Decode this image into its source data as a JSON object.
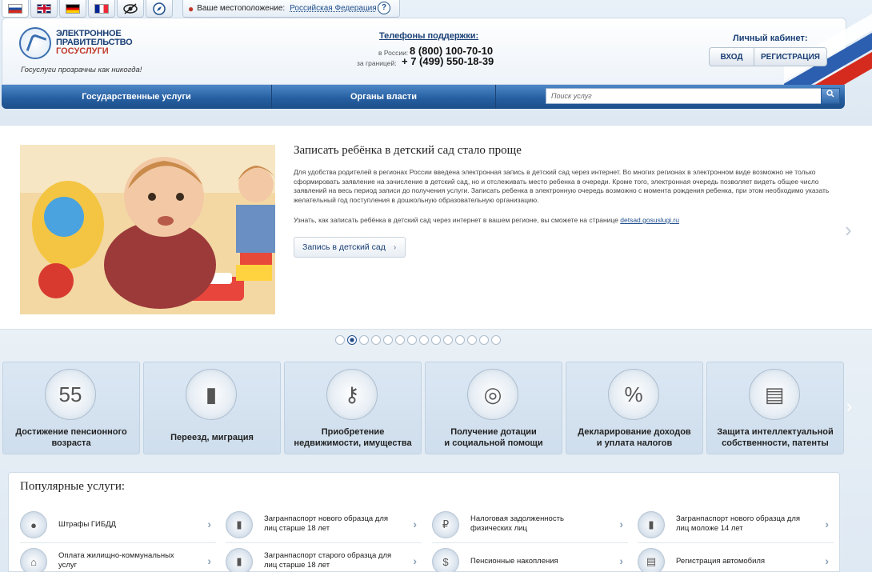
{
  "colors": {
    "brand_blue": "#245d9f",
    "accent_red": "#c0392b",
    "link": "#1f4e8c"
  },
  "flags": [
    "ru-flag-icon",
    "gb-flag-icon",
    "de-flag-icon",
    "fr-flag-icon",
    "low-vision-icon",
    "compass-icon"
  ],
  "location": {
    "label": "Ваше местоположение:",
    "value": "Российская Федерация"
  },
  "logo": {
    "line1": "ЭЛЕКТРОННОЕ",
    "line2": "ПРАВИТЕЛЬСТВО",
    "line3": "ГОСУСЛУГИ",
    "slogan": "Госуслуги прозрачны как никогда!"
  },
  "support": {
    "title": "Телефоны поддержки",
    "russia_label": "в России:",
    "russia_phone": "8 (800) 100-70-10",
    "abroad_label": "за границей:",
    "abroad_phone": "+ 7 (499) 550-18-39"
  },
  "cabinet": {
    "title": "Личный кабинет:",
    "login": "ВХОД",
    "register": "РЕГИСТРАЦИЯ"
  },
  "nav": {
    "services": "Государственные услуги",
    "authorities": "Органы власти"
  },
  "search": {
    "placeholder": "Поиск услуг"
  },
  "promo": {
    "title": "Записать ребёнка в детский сад стало проще",
    "text": "Для удобства родителей в регионах России введена электронная запись в детский сад через интернет. Во многих регионах в электронном виде возможно не только сформировать заявление на зачисление в детский сад, но и отслеживать место ребенка в очереди. Кроме того, электронная очередь позволяет видеть общее число заявлений на весь период записи до получения услуги. Записать ребенка в электронную очередь возможно с момента рождения ребенка, при этом необходимо указать желательный год поступления в дошкольную образовательную организацию.",
    "text2": "Узнать, как записать ребёнка в детский сад через интернет в вашем регионе, вы сможете на странице",
    "link": "detsad.gosuslugi.ru",
    "button": "Запись в детский сад"
  },
  "slider": {
    "total": 14,
    "active": 2
  },
  "categories": [
    {
      "l1": "Достижение пенсионного",
      "l2": "возраста",
      "icon": "calendar-55-icon",
      "glyph": "55"
    },
    {
      "l1": "Переезд, миграция",
      "l2": "",
      "icon": "passport-icon",
      "glyph": "▮"
    },
    {
      "l1": "Приобретение",
      "l2": "недвижимости, имущества",
      "icon": "keys-icon",
      "glyph": "⚷"
    },
    {
      "l1": "Получение дотации",
      "l2": "и социальной помощи",
      "icon": "lifebuoy-icon",
      "glyph": "◎"
    },
    {
      "l1": "Декларирование доходов",
      "l2": "и уплата налогов",
      "icon": "percent-icon",
      "glyph": "%"
    },
    {
      "l1": "Защита интеллектуальной",
      "l2": "собственности, патенты",
      "icon": "certificate-icon",
      "glyph": "▤"
    }
  ],
  "popular": {
    "title": "Популярные услуги:",
    "items": [
      {
        "text": "Штрафы ГИБДД",
        "icon": "traffic-light-icon",
        "glyph": "●"
      },
      {
        "text": "Загранпаспорт нового образца для лиц старше 18 лет",
        "icon": "passport-icon",
        "glyph": "▮"
      },
      {
        "text": "Налоговая задолженность физических лиц",
        "icon": "tax-icon",
        "glyph": "₽"
      },
      {
        "text": "Загранпаспорт нового образца для лиц моложе 14 лет",
        "icon": "passport-icon",
        "glyph": "▮"
      },
      {
        "text": "Оплата жилищно-коммунальных услуг",
        "icon": "utilities-icon",
        "glyph": "⌂"
      },
      {
        "text": "Загранпаспорт старого образца для лиц старше 18 лет",
        "icon": "passport-icon",
        "glyph": "▮"
      },
      {
        "text": "Пенсионные накопления",
        "icon": "pension-icon",
        "glyph": "$"
      },
      {
        "text": "Регистрация автомобиля",
        "icon": "car-doc-icon",
        "glyph": "▤"
      }
    ]
  }
}
